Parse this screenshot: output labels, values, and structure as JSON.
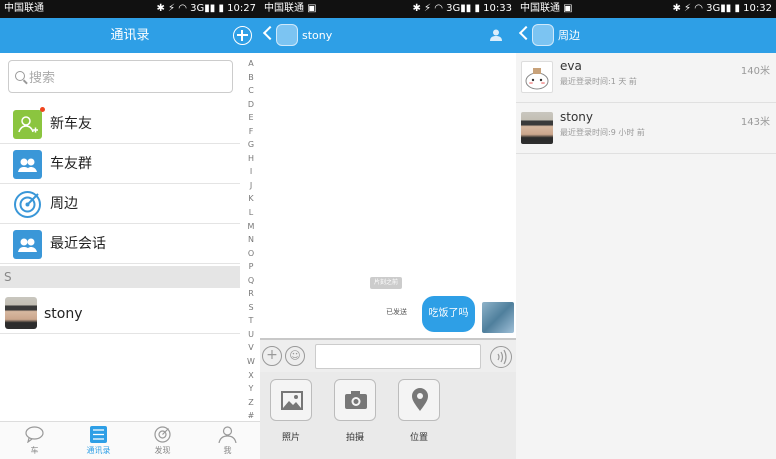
{
  "status_bars": [
    {
      "carrier": "中国联通",
      "time": "10:27",
      "signal": "3G"
    },
    {
      "carrier": "中国联通",
      "time": "10:33",
      "signal": "3G"
    },
    {
      "carrier": "中国联通",
      "time": "10:32",
      "signal": "3G"
    }
  ],
  "contacts": {
    "title": "通讯录",
    "search_placeholder": "搜索",
    "items": [
      {
        "label": "新车友",
        "icon": "person-add-icon",
        "badge": true
      },
      {
        "label": "车友群",
        "icon": "group-icon"
      },
      {
        "label": "周边",
        "icon": "nearby-radar-icon"
      },
      {
        "label": "最近会话",
        "icon": "recent-chat-icon"
      }
    ],
    "section_letter": "S",
    "contact_name": "stony",
    "alphabet": [
      "A",
      "B",
      "C",
      "D",
      "E",
      "F",
      "G",
      "H",
      "I",
      "J",
      "K",
      "L",
      "M",
      "N",
      "O",
      "P",
      "Q",
      "R",
      "S",
      "T",
      "U",
      "V",
      "W",
      "X",
      "Y",
      "Z",
      "#"
    ]
  },
  "tabbar": [
    {
      "label": "车",
      "icon": "chat-bubble-icon",
      "active": false
    },
    {
      "label": "通讯录",
      "icon": "contacts-list-icon",
      "active": true
    },
    {
      "label": "发现",
      "icon": "discover-icon",
      "active": false
    },
    {
      "label": "我",
      "icon": "profile-icon",
      "active": false
    }
  ],
  "chat": {
    "title": "stony",
    "time_label": "片刻之前",
    "sent_label": "已发送",
    "message": "吃饭了吗",
    "attachments": [
      {
        "label": "照片",
        "icon": "photo-icon"
      },
      {
        "label": "拍摄",
        "icon": "camera-icon"
      },
      {
        "label": "位置",
        "icon": "location-pin-icon"
      }
    ]
  },
  "nearby": {
    "title": "周边",
    "people": [
      {
        "name": "eva",
        "last_login": "最近登录时间:1 天 前",
        "distance": "140米"
      },
      {
        "name": "stony",
        "last_login": "最近登录时间:9 小时 前",
        "distance": "143米"
      }
    ]
  }
}
